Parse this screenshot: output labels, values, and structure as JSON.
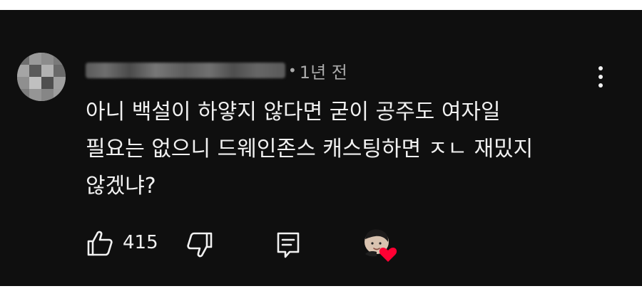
{
  "comment": {
    "author_blurred": true,
    "separator": "•",
    "time": "1년 전",
    "text_lines": [
      "아니 백설이 하얗지 않다면 굳이 공주도 여자일",
      "필요는 없으니 드웨인존스 캐스팅하면 ㅈㄴ 재밌지",
      "않겠냐?"
    ]
  },
  "actions": {
    "like_count": "415",
    "like_icon": "thumbs-up-icon",
    "dislike_icon": "thumbs-down-icon",
    "reply_icon": "reply-icon",
    "creator_heart": "creator-heart-icon"
  },
  "colors": {
    "background": "#0f0f0f",
    "text": "#f1f1f1",
    "secondary_text": "#aaaaaa",
    "heart": "#ff0033"
  }
}
